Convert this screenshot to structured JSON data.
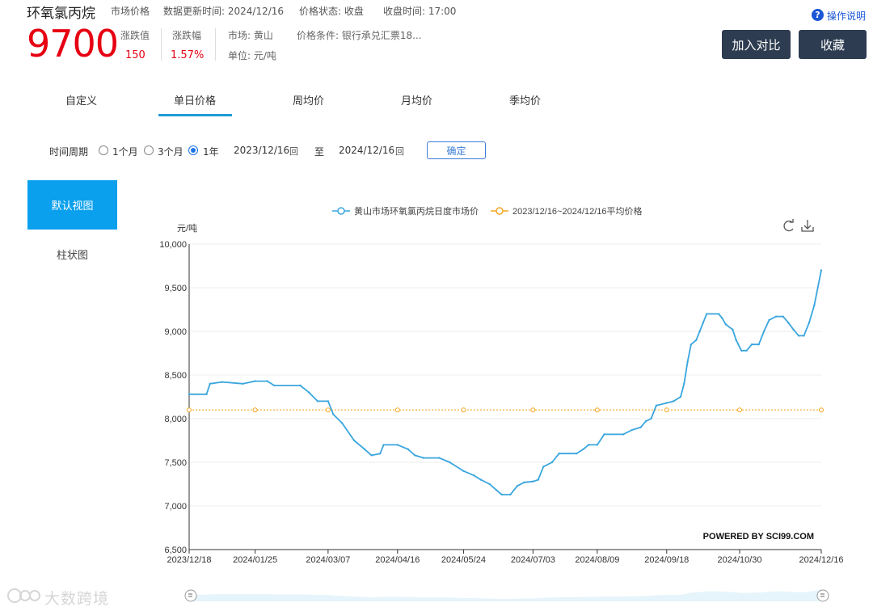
{
  "header": {
    "title": "环氧氯丙烷",
    "market_price_label": "市场价格",
    "update_time": "数据更新时间:  2024/12/16",
    "price_status": "价格状态:  收盘",
    "close_time": "收盘时间:  17:00",
    "price": "9700",
    "change_label": "涨跌值",
    "change_value": "150",
    "change_pct_label": "涨跌幅",
    "change_pct_value": "1.57%",
    "market": "市场: 黄山",
    "unit": "单位: 元/吨",
    "price_condition": "价格条件: 银行承兑汇票18...",
    "compare_button": "加入对比",
    "favorite_button": "收藏",
    "help_link": "操作说明",
    "help_icon_glyph": "?"
  },
  "tabs": [
    "自定义",
    "单日价格",
    "周均价",
    "月均价",
    "季均价"
  ],
  "active_tab": 1,
  "period": {
    "label": "时间周期",
    "options": [
      "1个月",
      "3个月",
      "1年"
    ],
    "selected": 2,
    "start_date": "2023/12/16",
    "to_label": "至",
    "end_date": "2024/12/16",
    "calendar_glyph": "回",
    "confirm_button": "确定"
  },
  "views": {
    "default": "默认视图",
    "bar": "柱状图"
  },
  "watermark": "大数跨境",
  "colors": {
    "price": "#e60012",
    "series": "#3aa6de",
    "average": "#f5a623",
    "accent": "#0aa0ee",
    "dark_button": "#2d3c50"
  },
  "chart_data": {
    "type": "line",
    "ylabel": "元/吨",
    "ylim": [
      6500,
      10000
    ],
    "yticks": [
      "6,500",
      "7,000",
      "7,500",
      "8,000",
      "8,500",
      "9,000",
      "9,500",
      "10,000"
    ],
    "x_tick_labels": [
      "2023/12/18",
      "2024/01/25",
      "2024/03/07",
      "2024/04/16",
      "2024/05/24",
      "2024/07/03",
      "2024/08/09",
      "2024/09/18",
      "2024/10/30",
      "2024/12/16"
    ],
    "credit": "POWERED BY SCI99.COM",
    "legend_position": "top",
    "series": [
      {
        "name": "黄山市场环氧氯丙烷日度市场价",
        "points": [
          [
            "2023/12/18",
            8280
          ],
          [
            "2023/12/28",
            8280
          ],
          [
            "2023/12/30",
            8400
          ],
          [
            "2024/01/06",
            8420
          ],
          [
            "2024/01/18",
            8400
          ],
          [
            "2024/01/25",
            8430
          ],
          [
            "2024/02/01",
            8430
          ],
          [
            "2024/02/05",
            8380
          ],
          [
            "2024/02/20",
            8380
          ],
          [
            "2024/02/25",
            8300
          ],
          [
            "2024/03/01",
            8200
          ],
          [
            "2024/03/07",
            8200
          ],
          [
            "2024/03/10",
            8050
          ],
          [
            "2024/03/15",
            7950
          ],
          [
            "2024/03/22",
            7750
          ],
          [
            "2024/03/28",
            7650
          ],
          [
            "2024/04/01",
            7580
          ],
          [
            "2024/04/06",
            7600
          ],
          [
            "2024/04/08",
            7700
          ],
          [
            "2024/04/16",
            7700
          ],
          [
            "2024/04/22",
            7650
          ],
          [
            "2024/04/26",
            7580
          ],
          [
            "2024/05/01",
            7550
          ],
          [
            "2024/05/10",
            7550
          ],
          [
            "2024/05/16",
            7500
          ],
          [
            "2024/05/24",
            7400
          ],
          [
            "2024/05/30",
            7350
          ],
          [
            "2024/06/03",
            7300
          ],
          [
            "2024/06/08",
            7250
          ],
          [
            "2024/06/12",
            7180
          ],
          [
            "2024/06/15",
            7130
          ],
          [
            "2024/06/20",
            7130
          ],
          [
            "2024/06/24",
            7230
          ],
          [
            "2024/06/28",
            7270
          ],
          [
            "2024/07/03",
            7280
          ],
          [
            "2024/07/06",
            7300
          ],
          [
            "2024/07/09",
            7450
          ],
          [
            "2024/07/14",
            7500
          ],
          [
            "2024/07/18",
            7600
          ],
          [
            "2024/07/28",
            7600
          ],
          [
            "2024/08/01",
            7650
          ],
          [
            "2024/08/04",
            7700
          ],
          [
            "2024/08/09",
            7700
          ],
          [
            "2024/08/13",
            7820
          ],
          [
            "2024/08/24",
            7820
          ],
          [
            "2024/08/29",
            7870
          ],
          [
            "2024/09/03",
            7900
          ],
          [
            "2024/09/06",
            7970
          ],
          [
            "2024/09/09",
            8000
          ],
          [
            "2024/09/12",
            8150
          ],
          [
            "2024/09/18",
            8180
          ],
          [
            "2024/09/22",
            8200
          ],
          [
            "2024/09/26",
            8250
          ],
          [
            "2024/09/28",
            8400
          ],
          [
            "2024/09/30",
            8650
          ],
          [
            "2024/10/02",
            8850
          ],
          [
            "2024/10/05",
            8900
          ],
          [
            "2024/10/07",
            9000
          ],
          [
            "2024/10/09",
            9100
          ],
          [
            "2024/10/11",
            9200
          ],
          [
            "2024/10/18",
            9200
          ],
          [
            "2024/10/20",
            9150
          ],
          [
            "2024/10/22",
            9080
          ],
          [
            "2024/10/26",
            9020
          ],
          [
            "2024/10/28",
            8900
          ],
          [
            "2024/10/31",
            8780
          ],
          [
            "2024/11/03",
            8780
          ],
          [
            "2024/11/06",
            8850
          ],
          [
            "2024/11/10",
            8850
          ],
          [
            "2024/11/13",
            9000
          ],
          [
            "2024/11/16",
            9130
          ],
          [
            "2024/11/20",
            9170
          ],
          [
            "2024/11/24",
            9170
          ],
          [
            "2024/11/27",
            9100
          ],
          [
            "2024/11/30",
            9020
          ],
          [
            "2024/12/03",
            8950
          ],
          [
            "2024/12/06",
            8950
          ],
          [
            "2024/12/09",
            9100
          ],
          [
            "2024/12/12",
            9300
          ],
          [
            "2024/12/16",
            9700
          ]
        ]
      },
      {
        "name": "2023/12/16~2024/12/16平均价格",
        "points": [
          [
            "2023/12/18",
            8100
          ],
          [
            "2024/12/16",
            8100
          ]
        ]
      }
    ]
  }
}
